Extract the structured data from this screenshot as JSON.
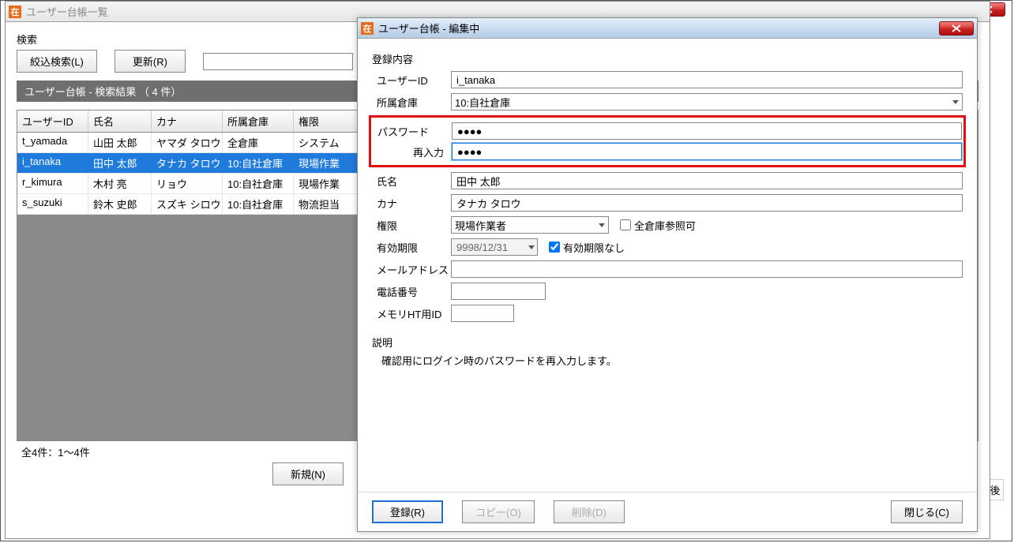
{
  "app_icon_char": "在",
  "main_window": {
    "title": "ユーザー台帳一覧",
    "search_label": "検索",
    "btn_filter": "絞込検索(L)",
    "btn_refresh": "更新(R)",
    "result_header": "ユーザー台帳 - 検索結果 （ 4 件）",
    "cols": {
      "c1": "ユーザーID",
      "c2": "氏名",
      "c3": "カナ",
      "c4": "所属倉庫",
      "c5": "権限"
    },
    "rows": [
      {
        "c1": "t_yamada",
        "c2": "山田 太郎",
        "c3": "ヤマダ タロウ",
        "c4": "全倉庫",
        "c5": "システム"
      },
      {
        "c1": "i_tanaka",
        "c2": "田中 太郎",
        "c3": "タナカ タロウ",
        "c4": "10:自社倉庫",
        "c5": "現場作業"
      },
      {
        "c1": "r_kimura",
        "c2": "木村 亮",
        "c3": "リョウ",
        "c4": "10:自社倉庫",
        "c5": "現場作業"
      },
      {
        "c1": "s_suzuki",
        "c2": "鈴木 史郎",
        "c3": "スズキ シロウ",
        "c4": "10:自社倉庫",
        "c5": "物流担当"
      }
    ],
    "selected_index": 1,
    "status": "全4件：1～4件",
    "btn_new": "新規(N)",
    "trailing_label": "後"
  },
  "dialog": {
    "title": "ユーザー台帳 - 編集中",
    "section_label": "登録内容",
    "labels": {
      "user_id": "ユーザーID",
      "warehouse": "所属倉庫",
      "password": "パスワード",
      "reenter": "再入力",
      "name": "氏名",
      "kana": "カナ",
      "role": "権限",
      "all_wh": "全倉庫参照可",
      "valid": "有効期限",
      "no_limit": "有効期限なし",
      "email": "メールアドレス",
      "phone": "電話番号",
      "ht_id": "メモリHT用ID",
      "desc": "説明"
    },
    "values": {
      "user_id": "i_tanaka",
      "warehouse": "10:自社倉庫",
      "password": "●●●●",
      "reenter": "●●●●",
      "name": "田中 太郎",
      "kana": "タナカ タロウ",
      "role": "現場作業者",
      "valid": "9998/12/31",
      "email": "",
      "phone": "",
      "ht_id": ""
    },
    "desc_text": "確認用にログイン時のパスワードを再入力します。",
    "buttons": {
      "register": "登録(R)",
      "copy": "コピー(O)",
      "delete": "削除(D)",
      "close": "閉じる(C)"
    }
  }
}
